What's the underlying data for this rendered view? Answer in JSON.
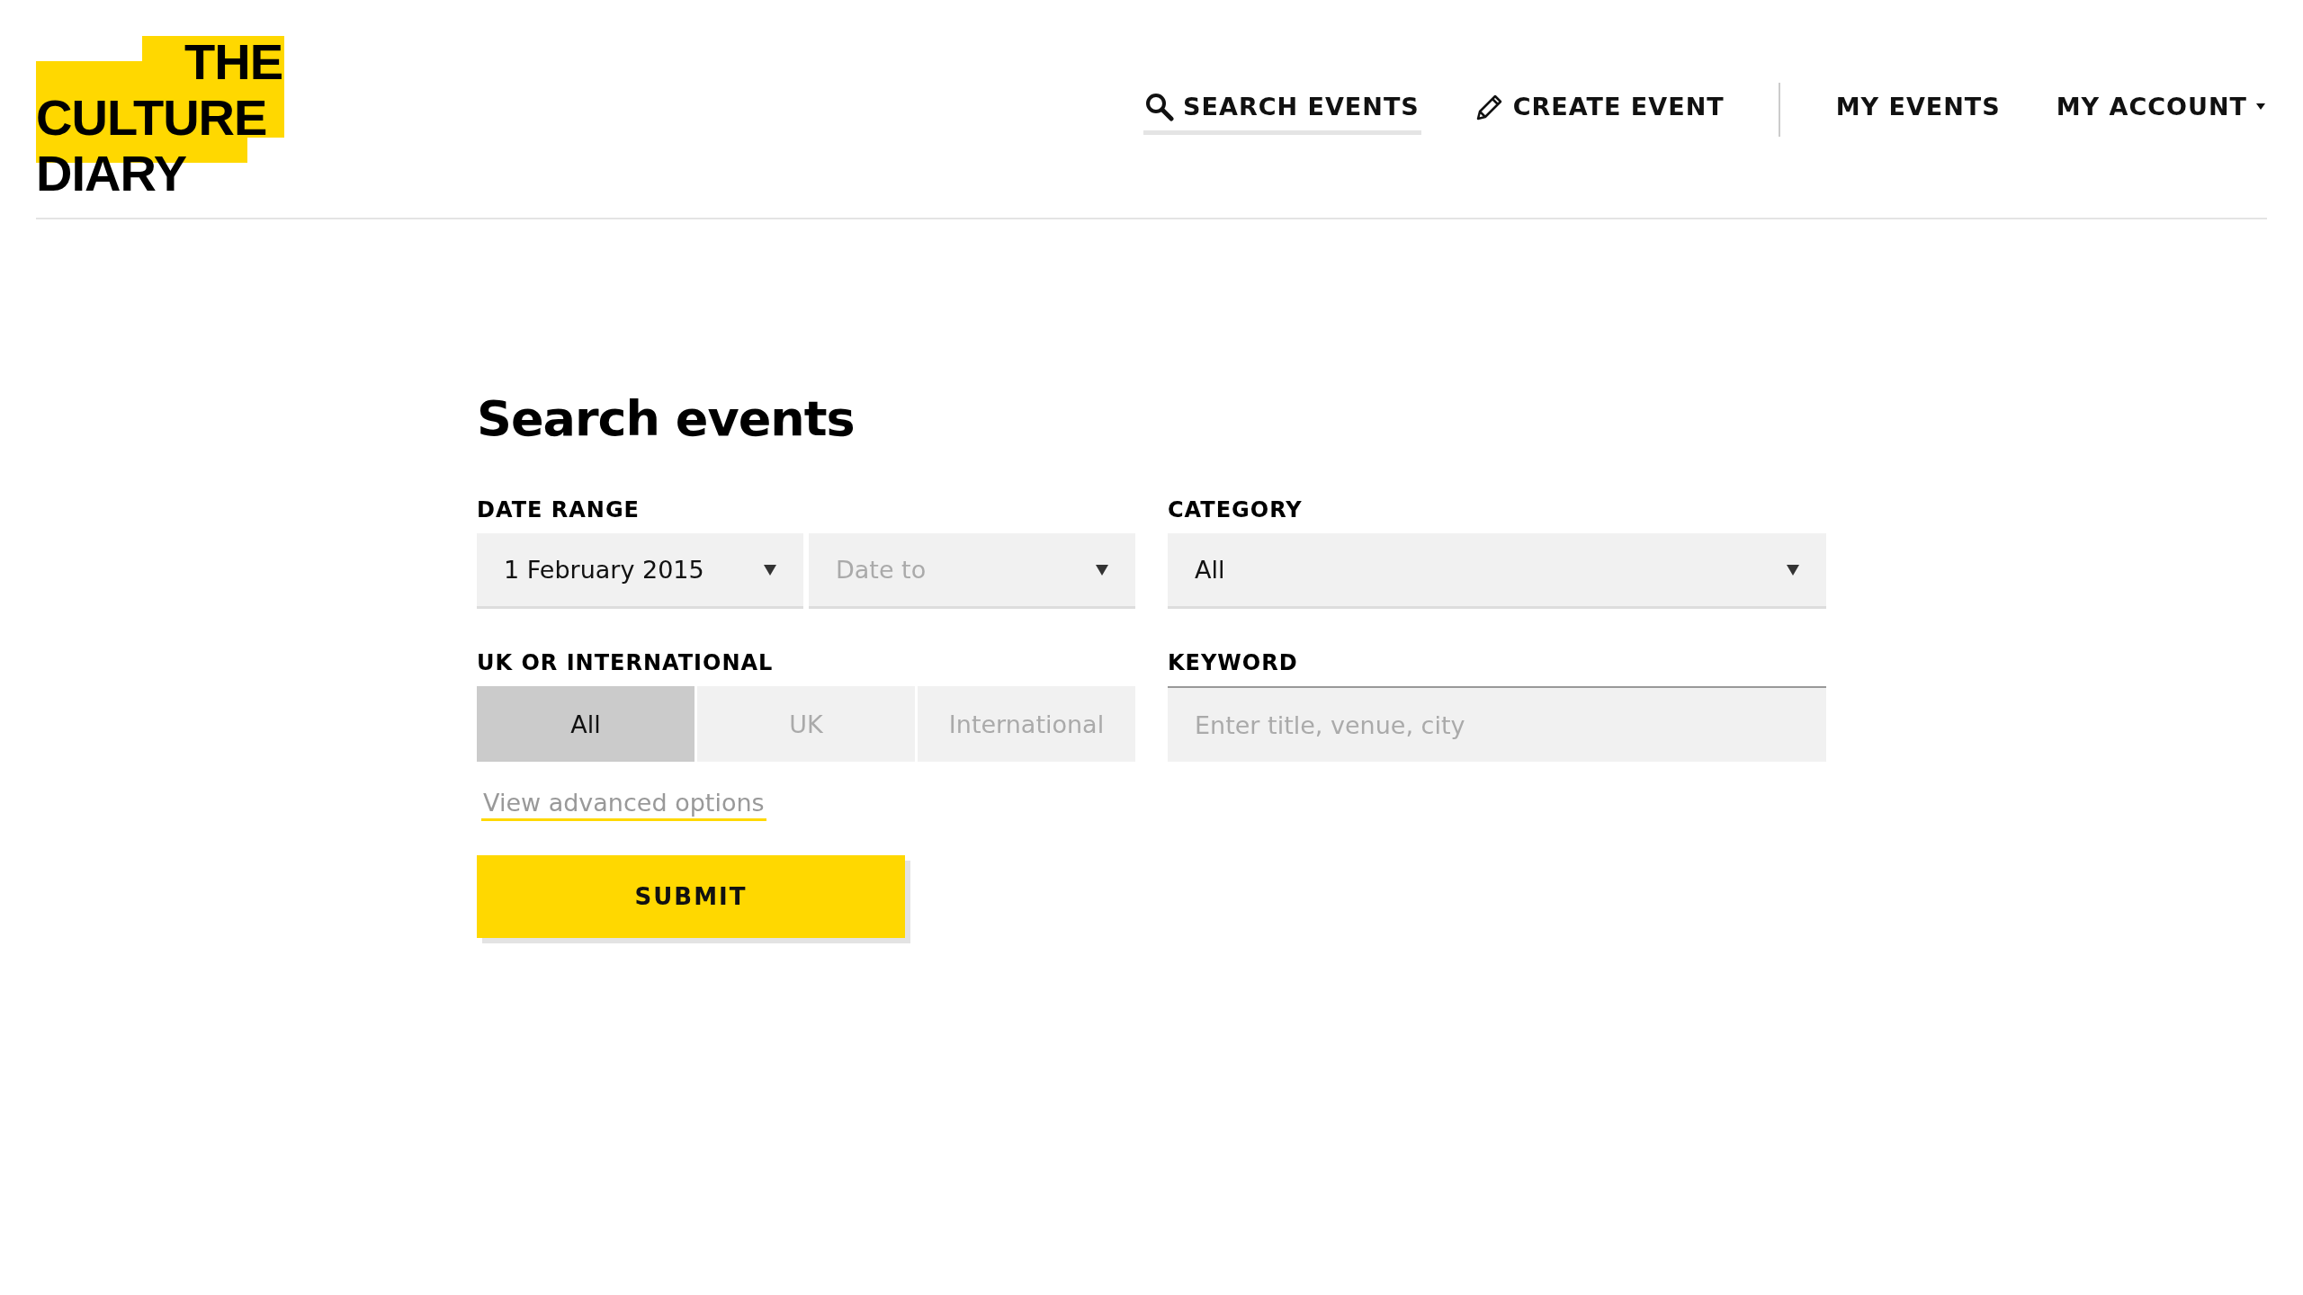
{
  "logo": {
    "lines": [
      "THE",
      "CULTURE",
      "DIARY"
    ]
  },
  "nav": [
    {
      "label": "SEARCH EVENTS",
      "kind": "search",
      "selected": true
    },
    {
      "label": "CREATE EVENT",
      "kind": "create",
      "selected": false
    },
    {
      "label": "MY EVENTS",
      "kind": "plain",
      "selected": false
    },
    {
      "label": "MY ACCOUNT",
      "kind": "menu",
      "selected": false
    }
  ],
  "title": "Search events",
  "date_range": {
    "label": "DATE RANGE",
    "from": {
      "value": "1 February 2015"
    },
    "to": {
      "placeholder": "Date to"
    }
  },
  "category": {
    "label": "CATEGORY",
    "value": "All"
  },
  "region": {
    "label": "UK OR INTERNATIONAL",
    "options": [
      {
        "label": "All",
        "selected": true
      },
      {
        "label": "UK",
        "selected": false
      },
      {
        "label": "International",
        "selected": false
      }
    ]
  },
  "keyword": {
    "label": "KEYWORD",
    "placeholder": "Enter title, venue, city"
  },
  "advanced_link": "View advanced options",
  "submit": "SUBMIT"
}
